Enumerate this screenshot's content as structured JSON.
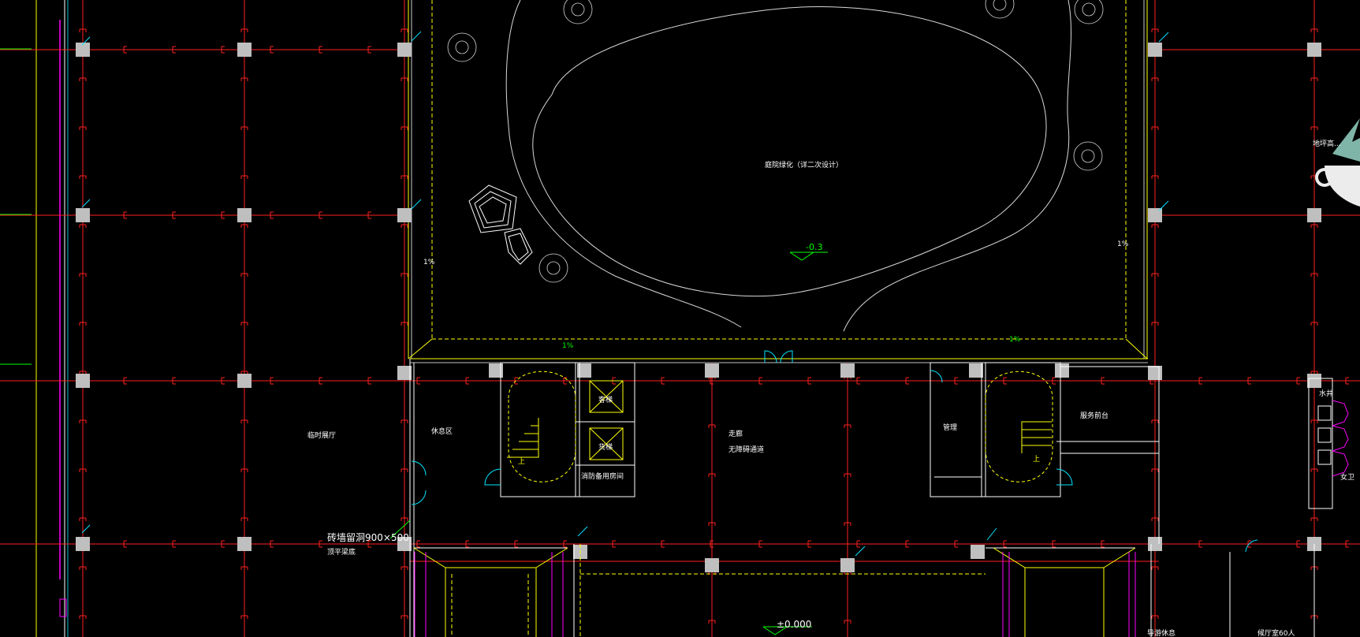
{
  "colors": {
    "background": "#000000",
    "grid": "#ff2020",
    "wall": "#ffffff",
    "landscape": "#d8d8d8",
    "yellow": "#ffff00",
    "cyan": "#00e5ff",
    "magenta": "#ff00ff",
    "green": "#00ff00",
    "column": "#bfbfbf"
  },
  "icons": {
    "column": "square-column-icon",
    "door": "door-swing-icon",
    "stair": "stair-icon",
    "elevator": "elevator-x-icon",
    "tree": "tree-symbol-icon",
    "rock": "rock-symbol-icon"
  },
  "labels": {
    "garden_note": "庭院绿化（详二次设计）",
    "pond_level": "-0.3",
    "slope_left": "1%",
    "slope_right": "1%",
    "slope_bottom_left": "1%",
    "slope_bottom_right": "1%",
    "exhibition_hall": "临时展厅",
    "rest_area": "休息区",
    "guest_elevator": "客梯",
    "freight_elevator": "货梯",
    "fire_room": "消防备用房间",
    "stair_up_left": "上",
    "stair_up_right": "上",
    "corridor": "走廊",
    "accessible": "无障碍通道",
    "management": "管理",
    "reception": "服务前台",
    "opening_note_1": "砖墙留洞900×500",
    "opening_note_2": "顶平梁底",
    "floor_level": "±0.000",
    "water": "水井",
    "toilet": "女卫",
    "bottom_room_1": "导游休息",
    "bottom_room_2": "候厅室60人",
    "right_note": "地坪高..."
  }
}
